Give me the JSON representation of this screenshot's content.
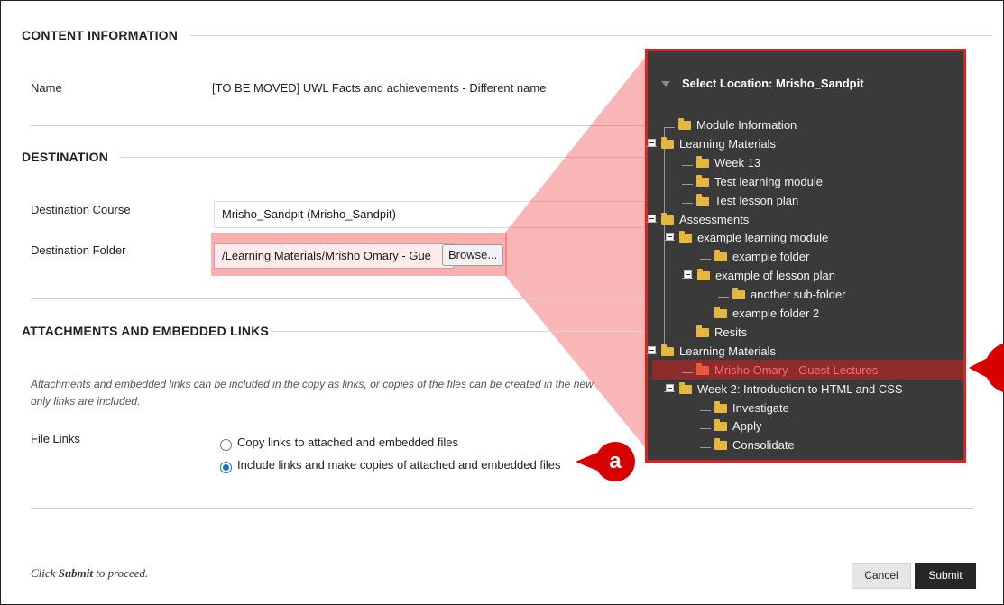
{
  "content_information": {
    "heading": "CONTENT INFORMATION",
    "name_label": "Name",
    "name_value": "[TO BE MOVED] UWL Facts and achievements - Different name"
  },
  "destination": {
    "heading": "DESTINATION",
    "course_label": "Destination Course",
    "course_value": "Mrisho_Sandpit (Mrisho_Sandpit)",
    "folder_label": "Destination Folder",
    "folder_value": "/Learning Materials/Mrisho Omary - Gue",
    "browse_label": "Browse..."
  },
  "attachments": {
    "heading": "ATTACHMENTS AND EMBEDDED LINKS",
    "note_line1": "Attachments and embedded links can be included in the copy as links, or copies of the files can be created in the new",
    "note_line2": "only links are included.",
    "file_links_label": "File Links",
    "options": [
      {
        "label": "Copy links to attached and embedded files",
        "selected": false
      },
      {
        "label": "Include links and make copies of attached and embedded files",
        "selected": true
      }
    ]
  },
  "footer": {
    "text_prefix": "Click ",
    "text_bold": "Submit",
    "text_suffix": " to proceed.",
    "cancel_label": "Cancel",
    "submit_label": "Submit"
  },
  "callouts": {
    "a_label": "a"
  },
  "tree": {
    "title": "Select Location: Mrisho_Sandpit",
    "nodes": [
      {
        "label": "Module Information",
        "expander": false
      },
      {
        "label": "Learning Materials",
        "expander": true
      },
      {
        "label": "Week 13",
        "expander": false
      },
      {
        "label": "Test learning module",
        "expander": false
      },
      {
        "label": "Test lesson plan",
        "expander": false
      },
      {
        "label": "Assessments",
        "expander": true
      },
      {
        "label": "example learning module",
        "expander": true
      },
      {
        "label": "example folder",
        "expander": false
      },
      {
        "label": "example of lesson plan",
        "expander": true
      },
      {
        "label": "another sub-folder",
        "expander": false
      },
      {
        "label": "example folder 2",
        "expander": false
      },
      {
        "label": "Resits",
        "expander": false
      },
      {
        "label": "Learning Materials",
        "expander": true
      },
      {
        "label": "Mrisho Omary - Guest Lectures",
        "expander": false,
        "selected": true
      },
      {
        "label": "Week 2: Introduction to HTML and CSS",
        "expander": true
      },
      {
        "label": "Investigate",
        "expander": false
      },
      {
        "label": "Apply",
        "expander": false
      },
      {
        "label": "Consolidate",
        "expander": false
      }
    ]
  },
  "colors": {
    "accent_red": "#d90000",
    "panel_bg": "#3a3a3a",
    "panel_border": "#e0201f",
    "radio_blue": "#1a73c8",
    "submit_bg": "#262626"
  }
}
